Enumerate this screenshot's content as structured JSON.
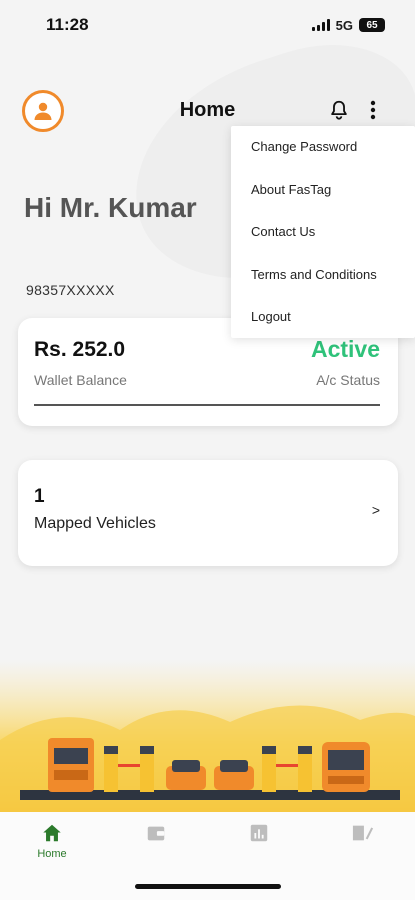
{
  "status_bar": {
    "time": "11:28",
    "network": "5G",
    "battery": "65"
  },
  "header": {
    "title": "Home"
  },
  "greeting": "Hi Mr. Kumar",
  "phone": "98357XXXXX",
  "wallet": {
    "amount": "Rs. 252.0",
    "amount_label": "Wallet Balance",
    "status": "Active",
    "status_label": "A/c Status"
  },
  "vehicles": {
    "count": "1",
    "label": "Mapped Vehicles",
    "arrow": ">"
  },
  "menu": {
    "items": [
      {
        "label": "Change Password"
      },
      {
        "label": "About FasTag"
      },
      {
        "label": "Contact Us"
      },
      {
        "label": "Terms and Conditions"
      },
      {
        "label": "Logout"
      }
    ]
  },
  "bottom_nav": {
    "items": [
      {
        "label": "Home",
        "icon": "home-icon",
        "active": true
      },
      {
        "label": "",
        "icon": "wallet-icon",
        "active": false
      },
      {
        "label": "",
        "icon": "bar-chart-icon",
        "active": false
      },
      {
        "label": "",
        "icon": "edit-icon",
        "active": false
      }
    ]
  },
  "colors": {
    "accent_orange": "#f08a2b",
    "active_green": "#2fc27a",
    "nav_active": "#2b7a2b",
    "illustration_yellow": "#f6c232"
  }
}
